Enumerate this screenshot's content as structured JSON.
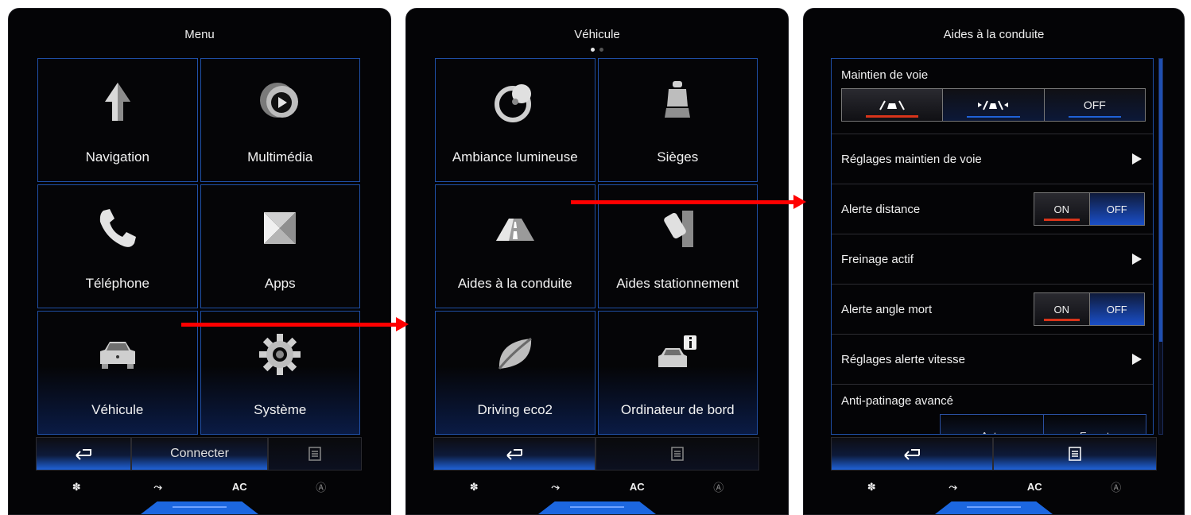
{
  "colors": {
    "accent": "#1f62d8",
    "tile_border": "#1f4fa6",
    "active_red": "#d8341a",
    "annotation_arrow": "#ff0000"
  },
  "panel1": {
    "title": "Menu",
    "tiles": [
      {
        "label": "Navigation",
        "icon": "navigation-arrow-icon"
      },
      {
        "label": "Multimédia",
        "icon": "play-icon"
      },
      {
        "label": "Téléphone",
        "icon": "phone-icon"
      },
      {
        "label": "Apps",
        "icon": "apps-icon"
      },
      {
        "label": "Véhicule",
        "icon": "car-icon"
      },
      {
        "label": "Système",
        "icon": "gear-icon"
      }
    ],
    "bottom": {
      "back_icon": "back-icon",
      "connect_label": "Connecter",
      "menu_icon": "list-icon"
    }
  },
  "panel2": {
    "title": "Véhicule",
    "page_dots": {
      "count": 2,
      "active": 1
    },
    "tiles": [
      {
        "label": "Ambiance lumineuse",
        "icon": "ambient-light-icon"
      },
      {
        "label": "Sièges",
        "icon": "seat-icon"
      },
      {
        "label": "Aides à la conduite",
        "icon": "road-icon"
      },
      {
        "label": "Aides stationnement",
        "icon": "parking-icon"
      },
      {
        "label": "Driving eco2",
        "icon": "eco-leaf-icon"
      },
      {
        "label": "Ordinateur de bord",
        "icon": "car-info-icon"
      }
    ],
    "bottom": {
      "back_icon": "back-icon",
      "menu_icon": "list-icon"
    }
  },
  "panel3": {
    "title": "Aides à la conduite",
    "rows": {
      "lane": {
        "label": "Maintien de voie",
        "options": [
          "",
          "",
          "OFF"
        ],
        "selected": 0
      },
      "lane_settings": {
        "label": "Réglages maintien de voie"
      },
      "distance": {
        "label": "Alerte distance",
        "on": "ON",
        "off": "OFF",
        "state": "ON"
      },
      "braking": {
        "label": "Freinage actif"
      },
      "blind": {
        "label": "Alerte angle mort",
        "on": "ON",
        "off": "OFF",
        "state": "ON"
      },
      "speed": {
        "label": "Réglages alerte vitesse"
      },
      "traction": {
        "label": "Anti-patinage avancé",
        "options": [
          "Auto",
          "Expert"
        ]
      }
    },
    "scroll_position": 0,
    "bottom": {
      "back_icon": "back-icon",
      "menu_icon": "list-icon"
    }
  },
  "climate": {
    "fan_icon": "fan-icon",
    "airflow_icon": "airflow-icon",
    "ac_label": "AC",
    "auto_icon": "auto-climate-icon"
  }
}
